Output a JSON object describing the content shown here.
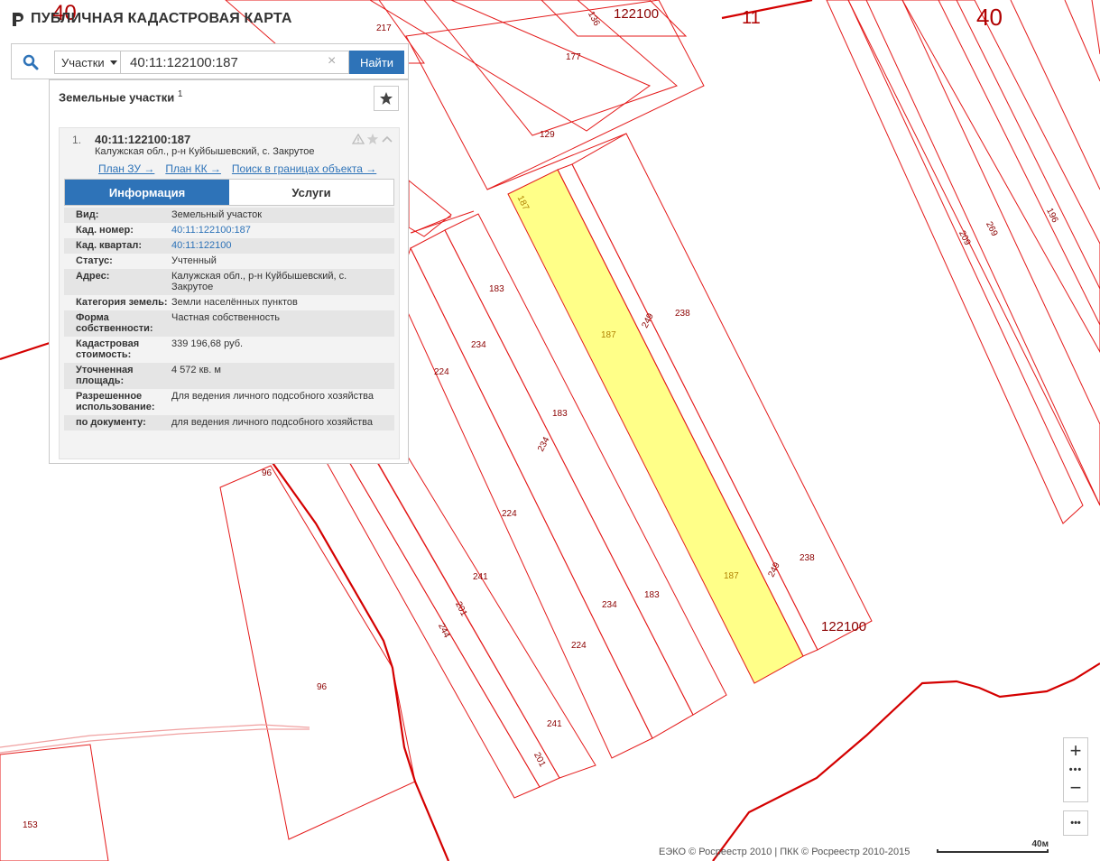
{
  "app": {
    "title": "ПУБЛИЧНАЯ КАДАСТРОВАЯ КАРТА"
  },
  "search": {
    "type_label": "Участки",
    "query": "40:11:122100:187",
    "find_label": "Найти",
    "clear_symbol": "×"
  },
  "results": {
    "title": "Земельные участки",
    "count": "1",
    "item": {
      "number": "1.",
      "kad": "40:11:122100:187",
      "address_short": "Калужская обл., р-н Куйбышевский, с. Закрутое",
      "links": [
        "План ЗУ →",
        "План КК →",
        "Поиск в границах объекта →"
      ],
      "tabs": [
        "Информация",
        "Услуги"
      ],
      "props": [
        {
          "key": "Вид:",
          "value": "Земельный участок"
        },
        {
          "key": "Кад. номер:",
          "value": "40:11:122100:187"
        },
        {
          "key": "Кад. квартал:",
          "value": "40:11:122100"
        },
        {
          "key": "Статус:",
          "value": "Учтенный"
        },
        {
          "key": "Адрес:",
          "value": "Калужская обл., р-н Куйбышевский, с. Закрутое"
        },
        {
          "key": "Категория земель:",
          "value": "Земли населённых пунктов"
        },
        {
          "key": "Форма собственности:",
          "value": "Частная собственность"
        },
        {
          "key": "Кадастровая стоимость:",
          "value": "339 196,68 руб."
        },
        {
          "key": "Уточненная площадь:",
          "value": "4 572 кв. м"
        },
        {
          "key": "Разрешенное использование:",
          "value": "Для ведения личного подсобного хозяйства"
        },
        {
          "key": "по документу:",
          "value": "для ведения личного подсобного хозяйства"
        }
      ]
    }
  },
  "map": {
    "labels": {
      "q40_left": "40",
      "q40_right": "40",
      "q11": "11",
      "q122100_top": "122100",
      "q122100_bottom": "122100",
      "p217": "217",
      "p136": "136",
      "p177": "177",
      "p129": "129",
      "p187a": "187",
      "p187b": "187",
      "p187c": "187",
      "p249a": "249",
      "p249b": "249",
      "p238a": "238",
      "p238b": "238",
      "p183a": "183",
      "p183b": "183",
      "p183c": "183",
      "p234a": "234",
      "p234b": "234",
      "p234c": "234",
      "p224a": "224",
      "p224b": "224",
      "p224c": "224",
      "p241a": "241",
      "p241b": "241",
      "p201a": "201",
      "p201b": "201",
      "p244": "244",
      "p96a": "96",
      "p96b": "96",
      "p153": "153",
      "p209": "209",
      "p269": "269",
      "p196": "196"
    },
    "highlight_color": "#ffff88",
    "boundary_color": "#d40000"
  },
  "controls": {
    "zoom_in": "+",
    "zoom_out": "−",
    "dots": "•••",
    "more": "•••"
  },
  "footer": {
    "copyright": "ЕЭКО © Росреестр 2010 | ПКК © Росреестр 2010-2015",
    "scale": "40м"
  }
}
